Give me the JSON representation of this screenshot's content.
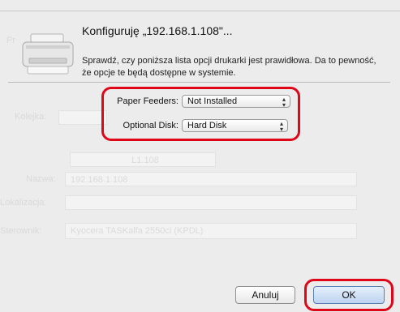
{
  "background": {
    "labels": [
      "Pr",
      "Kolejka:",
      "Nazwa:",
      "Lokalizacja:",
      "Sterownik:"
    ],
    "name_value": "192.168.1.108",
    "address_value": "L1.108",
    "driver_value": "Kyocera TASKalfa 2550ci (KPDL)"
  },
  "dialog": {
    "title": "Konfiguruję „192.168.1.108\"...",
    "description": "Sprawdź, czy poniższa lista opcji drukarki jest prawidłowa. Da to pewność, że opcje te będą dostępne w systemie.",
    "icon": "printer-icon",
    "options": [
      {
        "label": "Paper Feeders:",
        "value": "Not Installed"
      },
      {
        "label": "Optional Disk:",
        "value": "Hard Disk"
      }
    ],
    "buttons": {
      "cancel": "Anuluj",
      "ok": "OK"
    },
    "highlight_color": "#e0061a"
  }
}
